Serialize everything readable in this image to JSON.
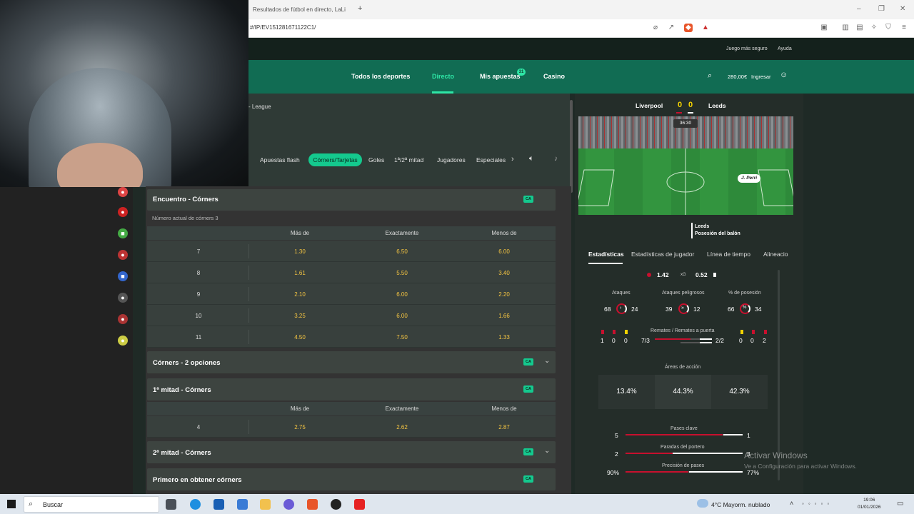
{
  "browser": {
    "tab_title": "Resultados de fútbol en directo, LaLi",
    "new_tab": "+",
    "address": "#/IP/EV151281671122C1/"
  },
  "site_top": {
    "links": [
      "Juego más seguro",
      "Ayuda"
    ]
  },
  "nav": {
    "items": [
      "Todos los deportes",
      "Directo",
      "Mis apuestas",
      "Casino"
    ],
    "badge": "31",
    "balance": "280,00€",
    "login": "Ingresar"
  },
  "league_crumb": "- League",
  "filters": [
    "Apuestas flash",
    "Córners/Tarjetas",
    "Goles",
    "1ª/2ª mitad",
    "Jugadores",
    "Especiales"
  ],
  "markets": {
    "encuentro": {
      "title": "Encuentro - Córners",
      "badge": "CA",
      "subtitle": "Número actual de córners 3",
      "columns": [
        "Más de",
        "Exactamente",
        "Menos de"
      ],
      "rows": [
        {
          "line": "7",
          "over": "1.30",
          "exact": "6.50",
          "under": "6.00"
        },
        {
          "line": "8",
          "over": "1.61",
          "exact": "5.50",
          "under": "3.40"
        },
        {
          "line": "9",
          "over": "2.10",
          "exact": "6.00",
          "under": "2.20"
        },
        {
          "line": "10",
          "over": "3.25",
          "exact": "6.00",
          "under": "1.66"
        },
        {
          "line": "11",
          "over": "4.50",
          "exact": "7.50",
          "under": "1.33"
        }
      ]
    },
    "dos_opciones": {
      "title": "Córners - 2 opciones",
      "badge": "CA"
    },
    "primera_mitad": {
      "title": "1ª mitad - Córners",
      "badge": "CA",
      "columns": [
        "Más de",
        "Exactamente",
        "Menos de"
      ],
      "row": {
        "line": "4",
        "over": "2.75",
        "exact": "2.62",
        "under": "2.87"
      }
    },
    "segunda_mitad": {
      "title": "2ª mitad - Córners",
      "badge": "CA"
    },
    "primero": {
      "title": "Primero en obtener córners",
      "badge": "CA"
    }
  },
  "match": {
    "home": "Liverpool",
    "away": "Leeds",
    "home_score": "0",
    "away_score": "0",
    "clock": "36:30",
    "player_tag": "J. Perri",
    "possession_team": "Leeds",
    "possession_label": "Posesión del balón"
  },
  "stat_tabs": [
    "Estadísticas",
    "Estadísticas de jugador",
    "Línea de tiempo",
    "Alineacio"
  ],
  "stats": {
    "xg_home": "1.42",
    "xg_label": "xG",
    "xg_away": "0.52",
    "attacks_label": "Ataques",
    "attacks_home": "68",
    "attacks_away": "24",
    "dangerous_label": "Ataques peligrosos",
    "dangerous_home": "39",
    "dangerous_away": "12",
    "possession_label": "% de posesión",
    "possession_home": "66",
    "possession_away": "34",
    "cards_home": [
      "1",
      "0",
      "0"
    ],
    "cards_away": [
      "0",
      "0",
      "2"
    ],
    "shots_label": "Remates / Remates a puerta",
    "shots_home": "7/3",
    "shots_away": "2/2",
    "areas_label": "Áreas de acción",
    "areas": [
      "13.4%",
      "44.3%",
      "42.3%"
    ],
    "key_passes_label": "Pases clave",
    "key_passes_home": "5",
    "key_passes_away": "1",
    "saves_label": "Paradas del portero",
    "saves_home": "2",
    "saves_away": "3",
    "pass_acc_label": "Precisión de pases",
    "pass_acc_home": "90%",
    "pass_acc_away": "77%"
  },
  "watermark": {
    "line1": "Activar Windows",
    "line2": "Ve a Configuración para activar Windows."
  },
  "taskbar": {
    "search": "Buscar",
    "weather": "4°C  Mayorm. nublado",
    "time": "19:06",
    "date": "01/01/2026"
  },
  "colors": {
    "brand_green": "#116c53",
    "accent": "#2ee6a6",
    "odds": "#f5c542",
    "home_red": "#c8102e"
  }
}
